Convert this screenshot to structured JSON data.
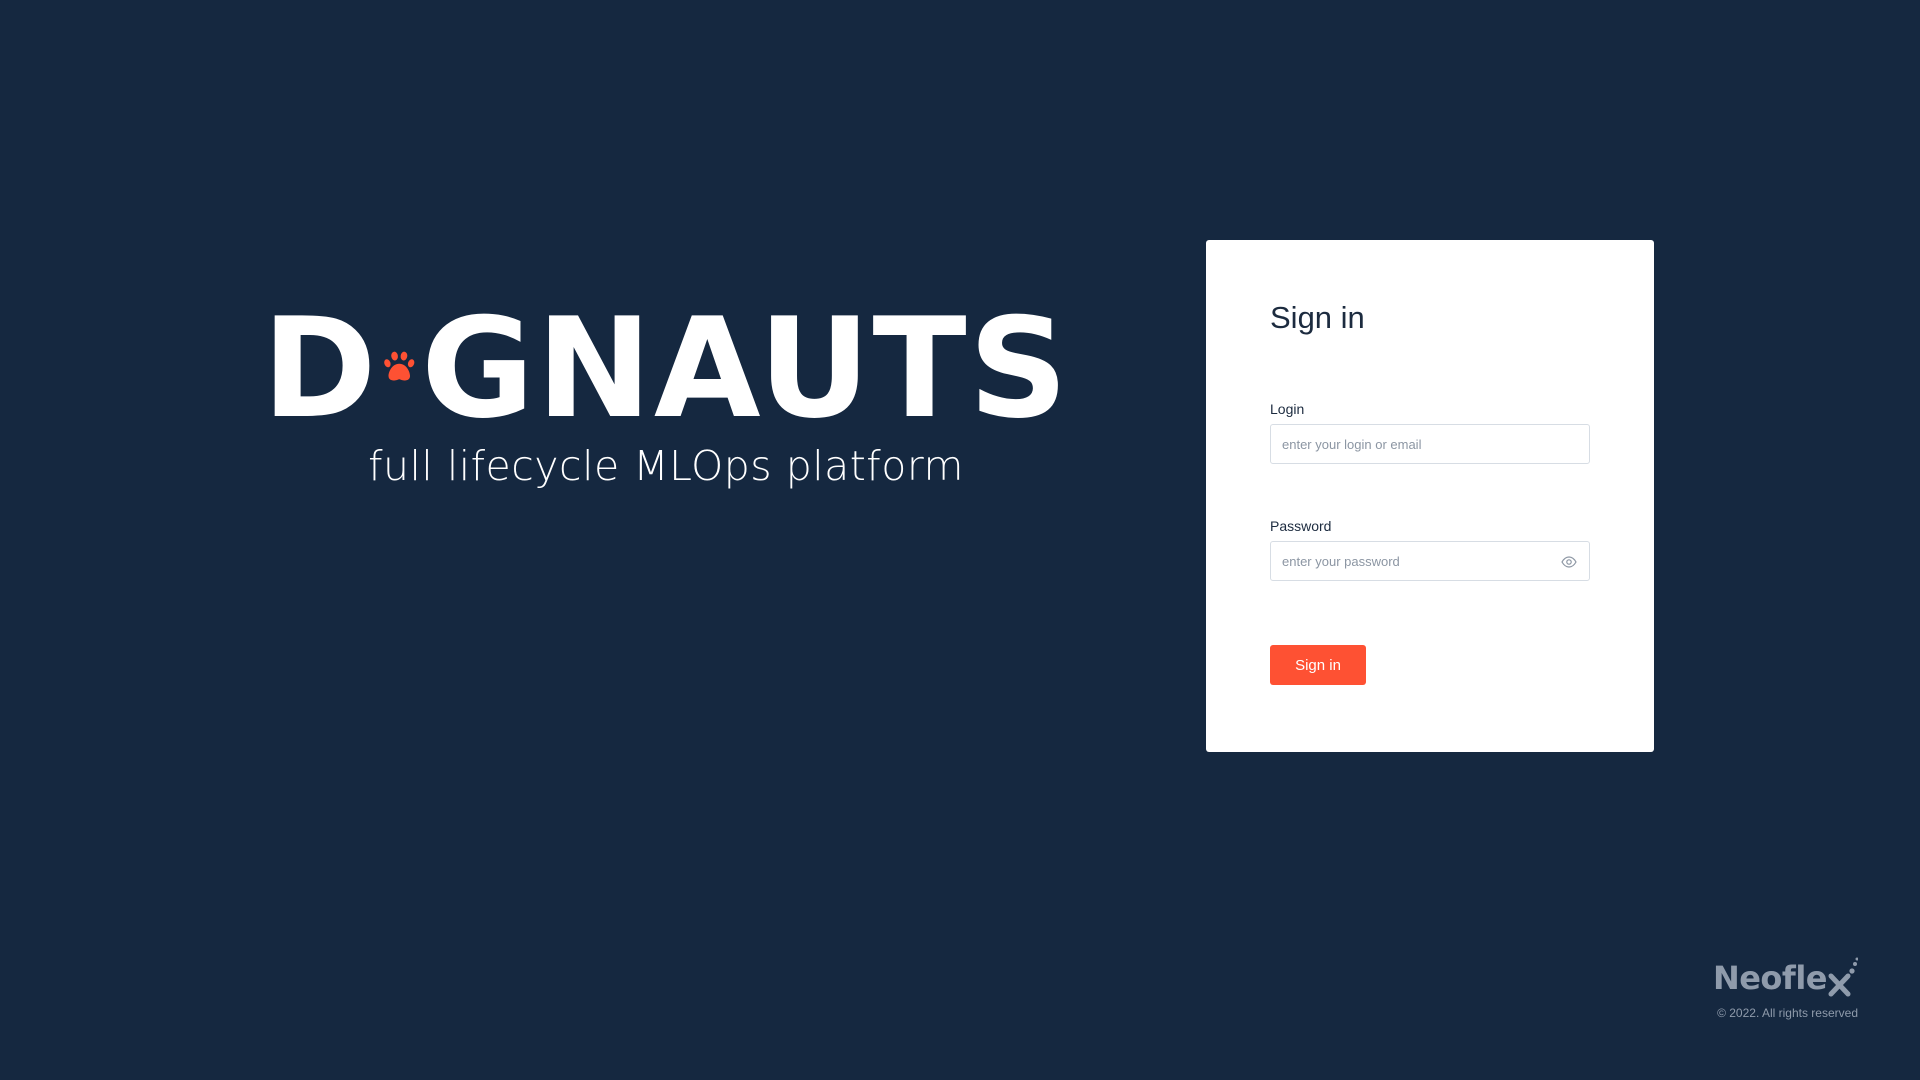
{
  "brand": {
    "logo_prefix": "D",
    "logo_suffix": "GNAUTS",
    "paw_icon": "paw-icon",
    "accent_color": "#FE5133",
    "tagline": "full lifecycle MLOps platform"
  },
  "signin": {
    "title": "Sign in",
    "login_label": "Login",
    "login_placeholder": "enter your login or email",
    "login_value": "",
    "password_label": "Password",
    "password_placeholder": "enter your password",
    "password_value": "",
    "password_toggle_icon": "eye-icon",
    "submit_label": "Sign in",
    "button_color": "#FE5133"
  },
  "footer": {
    "company_text": "Neofle",
    "company_mark_icon": "neoflex-x-icon",
    "copyright": "© 2022. All rights reserved"
  },
  "colors": {
    "background": "#152840",
    "card": "#FFFFFF",
    "text_dark": "#1C2B3F",
    "muted": "#8F9BAB"
  }
}
